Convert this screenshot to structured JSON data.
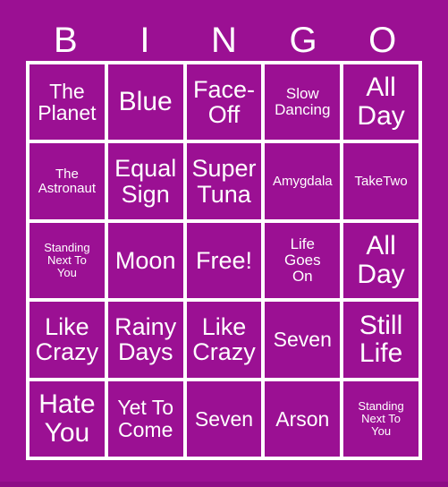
{
  "card": {
    "title": "BINGO",
    "background_color": "#9b1093",
    "cell_color": "#9b1093",
    "grid_line_color": "#ffffff",
    "text_color": "#ffffff",
    "columns": 5,
    "rows": 5
  },
  "header": {
    "letters": [
      "B",
      "I",
      "N",
      "G",
      "O"
    ]
  },
  "grid": {
    "cells": [
      {
        "text": "The\nPlanet",
        "size": "md",
        "free": false
      },
      {
        "text": "Blue",
        "size": "xl",
        "free": false
      },
      {
        "text": "Face-\nOff",
        "size": "lg",
        "free": false
      },
      {
        "text": "Slow\nDancing",
        "size": "sm",
        "free": false
      },
      {
        "text": "All\nDay",
        "size": "xl",
        "free": false
      },
      {
        "text": "The\nAstronaut",
        "size": "xs",
        "free": false
      },
      {
        "text": "Equal\nSign",
        "size": "lg",
        "free": false
      },
      {
        "text": "Super\nTuna",
        "size": "lg",
        "free": false
      },
      {
        "text": "Amygdala",
        "size": "xs",
        "free": false
      },
      {
        "text": "TakeTwo",
        "size": "xs",
        "free": false
      },
      {
        "text": "Standing\nNext To\nYou",
        "size": "xxs",
        "free": false
      },
      {
        "text": "Moon",
        "size": "lg",
        "free": false
      },
      {
        "text": "Free!",
        "size": "lg",
        "free": true
      },
      {
        "text": "Life\nGoes\nOn",
        "size": "sm",
        "free": false
      },
      {
        "text": "All\nDay",
        "size": "xl",
        "free": false
      },
      {
        "text": "Like\nCrazy",
        "size": "lg",
        "free": false
      },
      {
        "text": "Rainy\nDays",
        "size": "lg",
        "free": false
      },
      {
        "text": "Like\nCrazy",
        "size": "lg",
        "free": false
      },
      {
        "text": "Seven",
        "size": "md",
        "free": false
      },
      {
        "text": "Still\nLife",
        "size": "xl",
        "free": false
      },
      {
        "text": "Hate\nYou",
        "size": "xl",
        "free": false
      },
      {
        "text": "Yet To\nCome",
        "size": "md",
        "free": false
      },
      {
        "text": "Seven",
        "size": "md",
        "free": false
      },
      {
        "text": "Arson",
        "size": "md",
        "free": false
      },
      {
        "text": "Standing\nNext To\nYou",
        "size": "xxs",
        "free": false
      }
    ]
  }
}
